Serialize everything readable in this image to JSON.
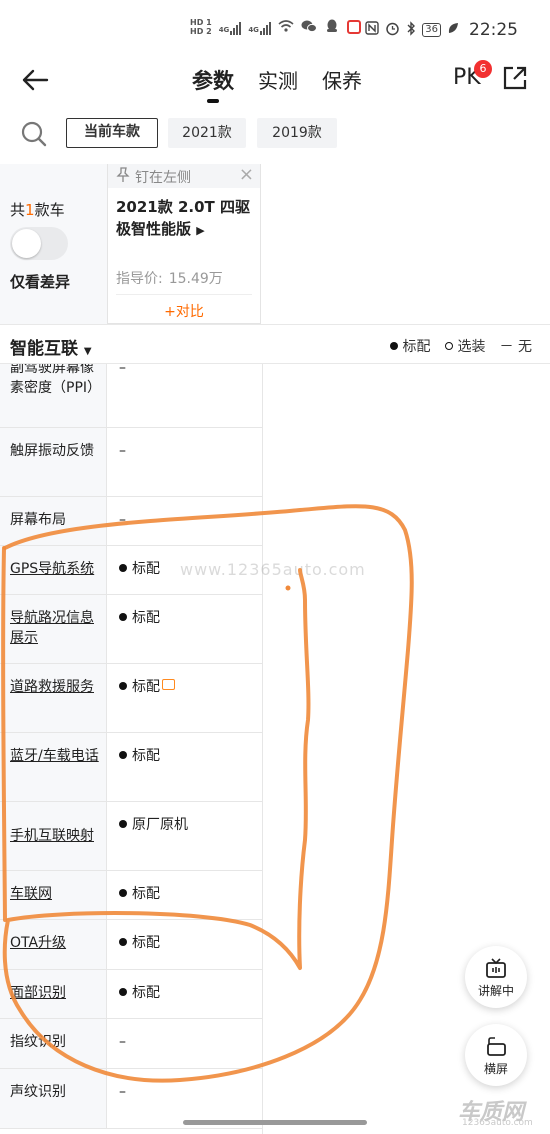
{
  "status": {
    "hd1": "HD 1",
    "hd2": "HD 2",
    "net1": "4G",
    "net2": "4G",
    "battery": "36",
    "time": "22:25"
  },
  "nav": {
    "tabs": [
      "参数",
      "实测",
      "保养"
    ],
    "pk": "PK",
    "pk_badge": "6"
  },
  "filter": {
    "chips": [
      "当前车款",
      "2021款",
      "2019款"
    ]
  },
  "carhead": {
    "count_prefix": "共",
    "count_num": "1",
    "count_suffix": "款车",
    "only_diff": "仅看差异",
    "pin_text": "钉在左侧",
    "car_name": "2021款 2.0T 四驱极智性能版",
    "price_label": "指导价:",
    "price_value": "15.49万",
    "compare": "+对比"
  },
  "section": {
    "title": "智能互联",
    "legend_std": "标配",
    "legend_opt": "选装",
    "legend_none": "－ 无"
  },
  "rows": [
    {
      "label": "副驾驶屏幕像素密度（PPI）",
      "value": "–"
    },
    {
      "label": "触屏振动反馈",
      "value": "–"
    },
    {
      "label": "屏幕布局",
      "value": "–"
    },
    {
      "label": "GPS导航系统",
      "value": "标配"
    },
    {
      "label": "导航路况信息展示",
      "value": "标配"
    },
    {
      "label": "道路救援服务",
      "value": "标配"
    },
    {
      "label": "蓝牙/车载电话",
      "value": "标配"
    },
    {
      "label": "手机互联映射",
      "value": "原厂原机"
    },
    {
      "label": "车联网",
      "value": "标配"
    },
    {
      "label": "OTA升级",
      "value": "标配"
    },
    {
      "label": "面部识别",
      "value": "标配"
    },
    {
      "label": "指纹识别",
      "value": "–"
    },
    {
      "label": "声纹识别",
      "value": "–"
    }
  ],
  "watermark": "www.12365auto.com",
  "fabs": {
    "explain": "讲解中",
    "landscape": "横屏"
  },
  "logo": {
    "main": "车质网",
    "sub": "12365auto.com"
  },
  "colors": {
    "accent": "#ff6a00",
    "badge": "#f23030",
    "annotation": "#f0893a"
  }
}
